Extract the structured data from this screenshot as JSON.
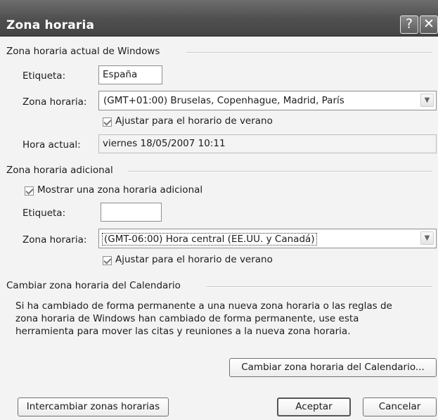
{
  "window": {
    "title": "Zona horaria",
    "help_glyph": "?",
    "close_glyph": "✕"
  },
  "current_zone": {
    "group_label": "Zona horaria actual de Windows",
    "label_label": "Etiqueta:",
    "label_value": "España",
    "zone_label": "Zona horaria:",
    "zone_value": "(GMT+01:00) Bruselas, Copenhague, Madrid, París",
    "dst_checked": true,
    "dst_label": "Ajustar para el horario de verano",
    "time_label": "Hora actual:",
    "time_value": "viernes 18/05/2007 10:11"
  },
  "additional_zone": {
    "group_label": "Zona horaria adicional",
    "show_checked": true,
    "show_label": "Mostrar una zona horaria adicional",
    "label_label": "Etiqueta:",
    "label_value": "",
    "zone_label": "Zona horaria:",
    "zone_value": "(GMT-06:00) Hora central (EE.UU. y Canadá)",
    "dst_checked": true,
    "dst_label": "Ajustar para el horario de verano"
  },
  "calendar": {
    "group_label": "Cambiar zona horaria del Calendario",
    "description": "Si ha cambiado de forma permanente a una nueva zona horaria o las reglas de zona horaria de Windows han cambiado de forma permanente, use esta herramienta para mover las citas y reuniones a la nueva zona horaria.",
    "button": "Cambiar zona horaria del Calendario..."
  },
  "footer": {
    "swap": "Intercambiar zonas horarias",
    "ok": "Aceptar",
    "cancel": "Cancelar"
  }
}
